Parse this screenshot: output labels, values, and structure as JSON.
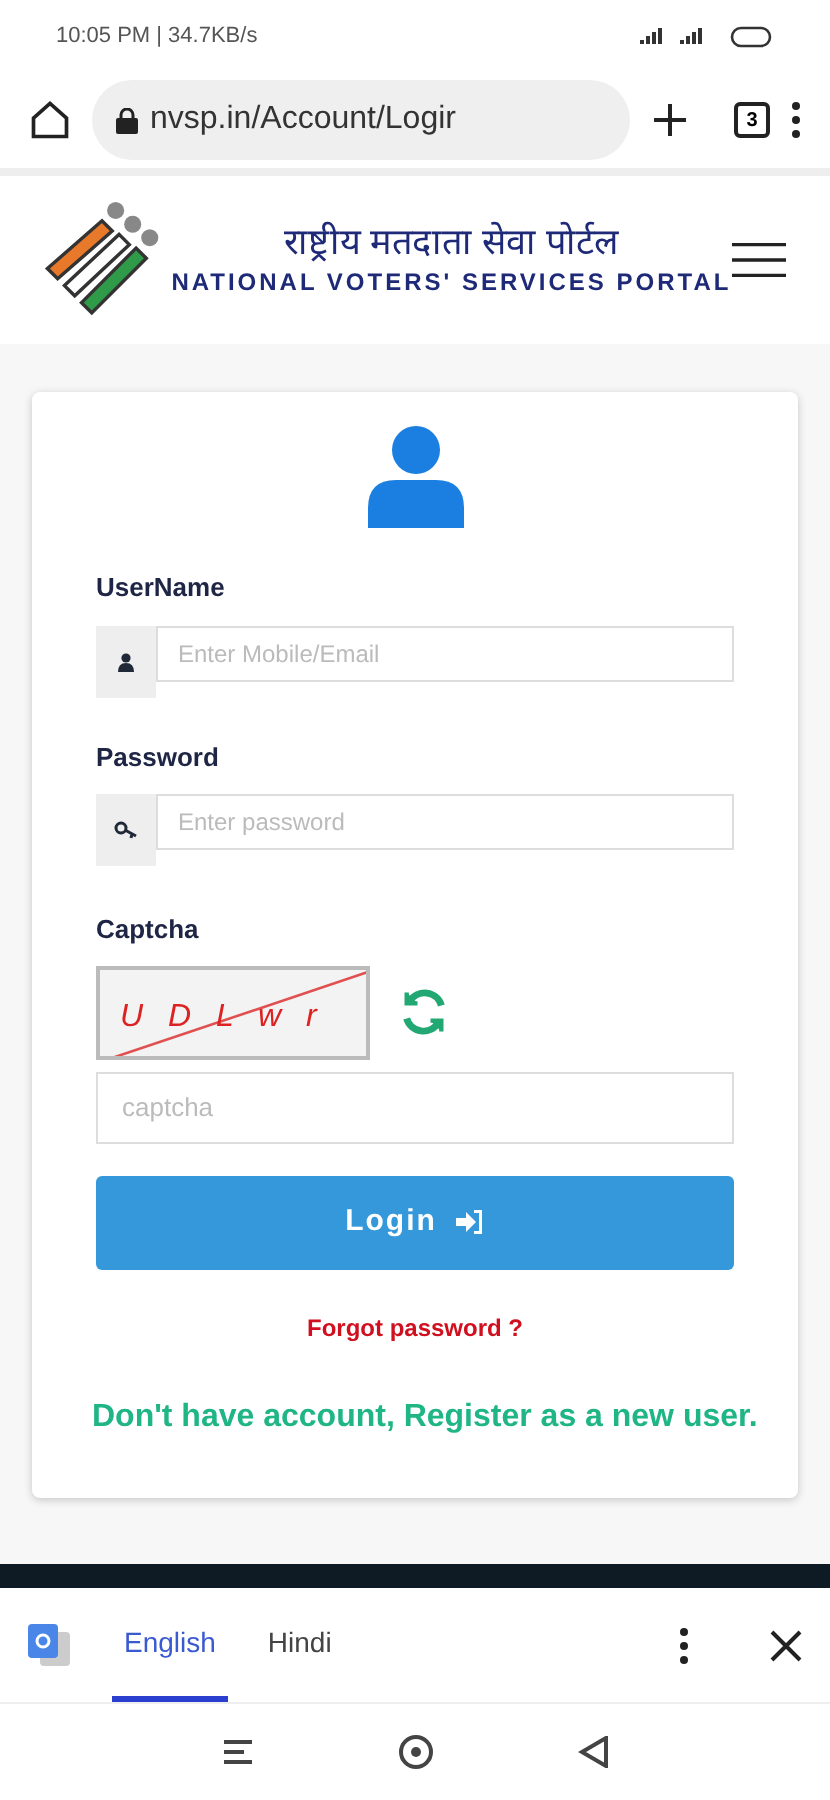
{
  "status_bar": {
    "time": "10:05 PM | 34.7KB/s"
  },
  "browser": {
    "url": "nvsp.in/Account/Logir",
    "tab_count": "3"
  },
  "header": {
    "title_hindi": "राष्ट्रीय मतदाता सेवा पोर्टल",
    "title_english": "NATIONAL VOTERS' SERVICES PORTAL"
  },
  "form": {
    "fields": [
      {
        "label": "UserName",
        "placeholder": "Enter Mobile/Email",
        "kind": "user"
      },
      {
        "label": "Password",
        "placeholder": "Enter password",
        "kind": "key"
      }
    ],
    "captcha": {
      "label": "Captcha",
      "image_text": "U D L w r",
      "placeholder": "captcha"
    },
    "login_button": "Login",
    "forgot": "Forgot password ?",
    "register": "Don't have account, Register as a new user."
  },
  "translate_bar": {
    "tabs": [
      {
        "label": "English",
        "selected": true
      },
      {
        "label": "Hindi",
        "selected": false
      }
    ]
  }
}
